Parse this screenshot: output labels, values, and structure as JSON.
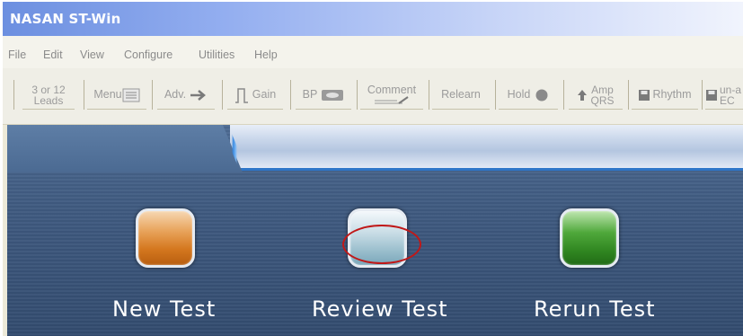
{
  "window": {
    "title": "NASAN ST-Win"
  },
  "menu": [
    "File",
    "Edit",
    "View",
    "Configure",
    "Utilities",
    "Help"
  ],
  "toolbar": {
    "leads_line1": "3 or 12",
    "leads_line2": "Leads",
    "menu": "Menu",
    "adv": "Adv.",
    "gain": "Gain",
    "bp": "BP",
    "comment": "Comment",
    "relearn": "Relearn",
    "hold": "Hold",
    "amp_line1": "Amp",
    "amp_line2": "QRS",
    "rhythm": "Rhythm",
    "unavg_line1": "un-a",
    "unavg_line2": "EC"
  },
  "tests": [
    {
      "label": "New Test",
      "color": "#d5781f"
    },
    {
      "label": "Review Test",
      "color": "#98bdcc"
    },
    {
      "label": "Rerun Test",
      "color": "#2f8520"
    }
  ],
  "annotation": {
    "color": "#c01818"
  }
}
